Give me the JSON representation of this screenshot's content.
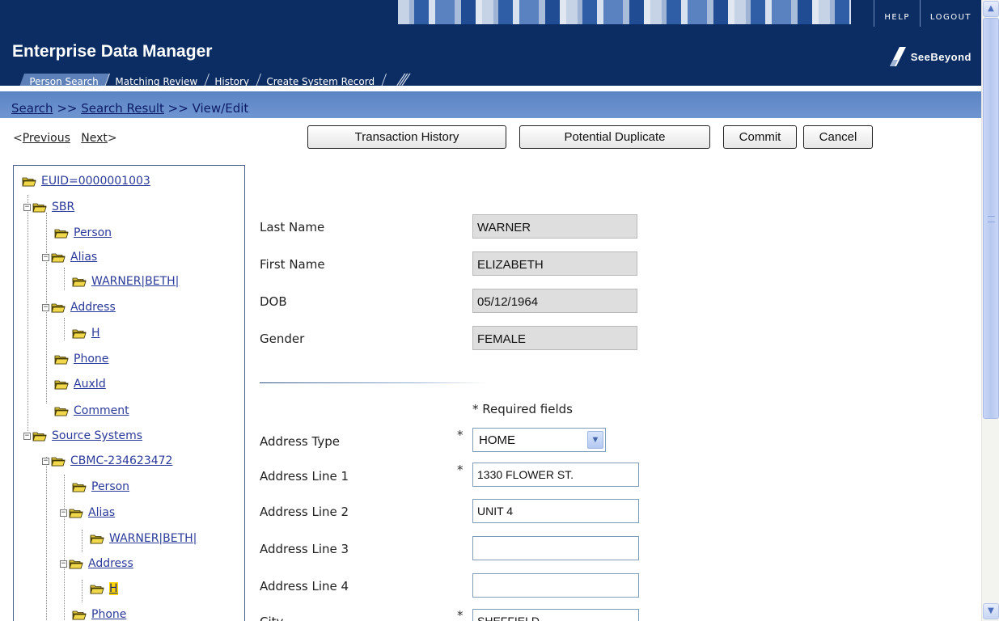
{
  "header": {
    "app_title": "Enterprise Data Manager",
    "help_label": "HELP",
    "logout_label": "LOGOUT",
    "logo_text": "SeeBeyond",
    "tabs": [
      {
        "label": "Person Search",
        "active": true
      },
      {
        "label": "Matching Review",
        "active": false
      },
      {
        "label": "History",
        "active": false
      },
      {
        "label": "Create System Record",
        "active": false
      }
    ],
    "tab_decoration": "///"
  },
  "breadcrumb": {
    "items": [
      "Search",
      "Search Result",
      "View/Edit"
    ],
    "separator": " >> "
  },
  "pager": {
    "previous_label": "Previous",
    "next_label": "Next",
    "lt": "<",
    "gt": ">"
  },
  "actions": {
    "transaction_history": "Transaction History",
    "potential_duplicate": "Potential Duplicate",
    "commit": "Commit",
    "cancel": "Cancel"
  },
  "tree": {
    "root": "EUID=0000001003",
    "sbr": "SBR",
    "sbr_person": "Person",
    "sbr_alias": "Alias",
    "sbr_alias_value": "WARNER|BETH|",
    "sbr_address": "Address",
    "sbr_address_value": "H",
    "sbr_phone": "Phone",
    "sbr_auxid": "AuxId",
    "sbr_comment": "Comment",
    "source_systems": "Source Systems",
    "system": "CBMC-234623472",
    "sys_person": "Person",
    "sys_alias": "Alias",
    "sys_alias_value": "WARNER|BETH|",
    "sys_address": "Address",
    "sys_address_value": "H",
    "sys_phone": "Phone"
  },
  "form": {
    "last_name_label": "Last Name",
    "last_name_value": "WARNER",
    "first_name_label": "First Name",
    "first_name_value": "ELIZABETH",
    "dob_label": "DOB",
    "dob_value": "05/12/1964",
    "gender_label": "Gender",
    "gender_value": "FEMALE",
    "required_note": "* Required fields",
    "required_marker": "*",
    "address_type_label": "Address Type",
    "address_type_value": "HOME",
    "address_line1_label": "Address Line 1",
    "address_line1_value": "1330 FLOWER ST.",
    "address_line2_label": "Address Line 2",
    "address_line2_value": "UNIT 4",
    "address_line3_label": "Address Line 3",
    "address_line3_value": "",
    "address_line4_label": "Address Line 4",
    "address_line4_value": "",
    "city_label": "City",
    "city_value": "SHEFFIELD"
  },
  "colors": {
    "header_bg": "#0b2d63",
    "crumb_bg": "#6f95d1",
    "link": "#2b3a9a",
    "highlight": "#ffd400"
  }
}
